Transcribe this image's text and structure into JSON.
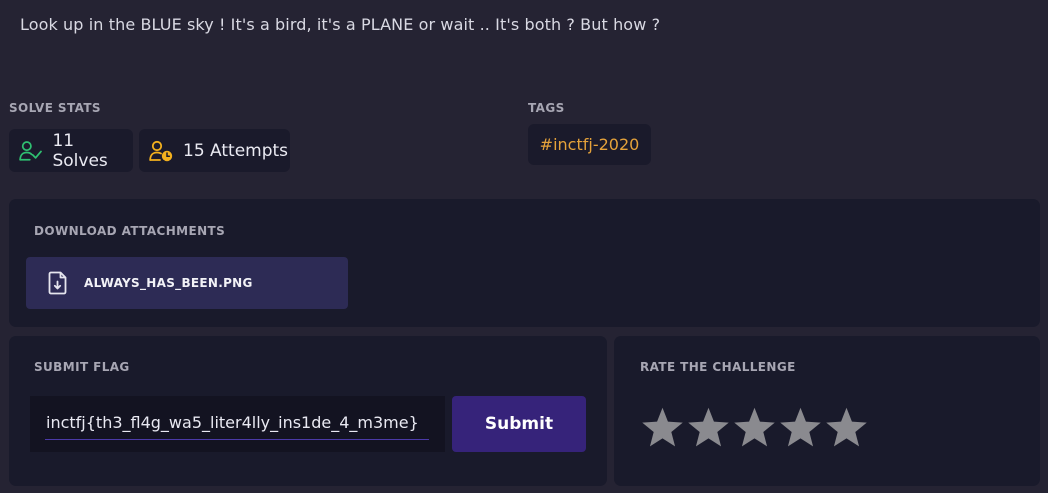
{
  "challenge": {
    "description": "Look up in the BLUE sky ! It's a bird, it's a PLANE or wait .. It's both ? But how ?"
  },
  "solve_stats": {
    "label": "SOLVE STATS",
    "solves": "11 Solves",
    "attempts": "15 Attempts",
    "colors": {
      "solves_icon": "#2fbf71",
      "attempts_icon": "#f2b01e"
    }
  },
  "tags": {
    "label": "TAGS",
    "items": [
      "#inctfj-2020"
    ]
  },
  "attachments": {
    "label": "DOWNLOAD ATTACHMENTS",
    "files": [
      {
        "name": "ALWAYS_HAS_BEEN.PNG",
        "icon": "file-download-icon"
      }
    ]
  },
  "submit": {
    "label": "SUBMIT FLAG",
    "value": "inctfj{th3_fl4g_wa5_liter4lly_ins1de_4_m3me}",
    "button_label": "Submit"
  },
  "rating": {
    "label": "RATE THE CHALLENGE",
    "max_stars": 5,
    "selected": 0,
    "star_color": "#8a8a8f"
  }
}
